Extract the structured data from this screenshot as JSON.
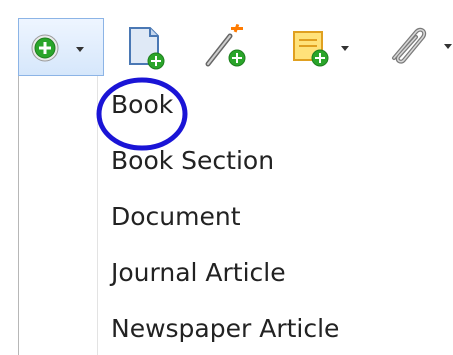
{
  "toolbar": {
    "buttons": [
      {
        "icon": "new-item-icon",
        "has_dropdown": true,
        "active": true
      },
      {
        "icon": "new-note-from-document-icon",
        "has_dropdown": false
      },
      {
        "icon": "add-item-by-identifier-icon",
        "has_dropdown": false
      },
      {
        "icon": "new-note-icon",
        "has_dropdown": true
      },
      {
        "icon": "attachment-icon",
        "has_dropdown": true
      }
    ]
  },
  "menu": {
    "items": [
      {
        "label": "Book",
        "highlighted": true
      },
      {
        "label": "Book Section"
      },
      {
        "label": "Document"
      },
      {
        "label": "Journal Article"
      },
      {
        "label": "Newspaper Article"
      }
    ]
  },
  "colors": {
    "annotation_circle": "#1a14d6",
    "green_plus": "#2aa52a",
    "button_border": "#8cb4e6"
  }
}
